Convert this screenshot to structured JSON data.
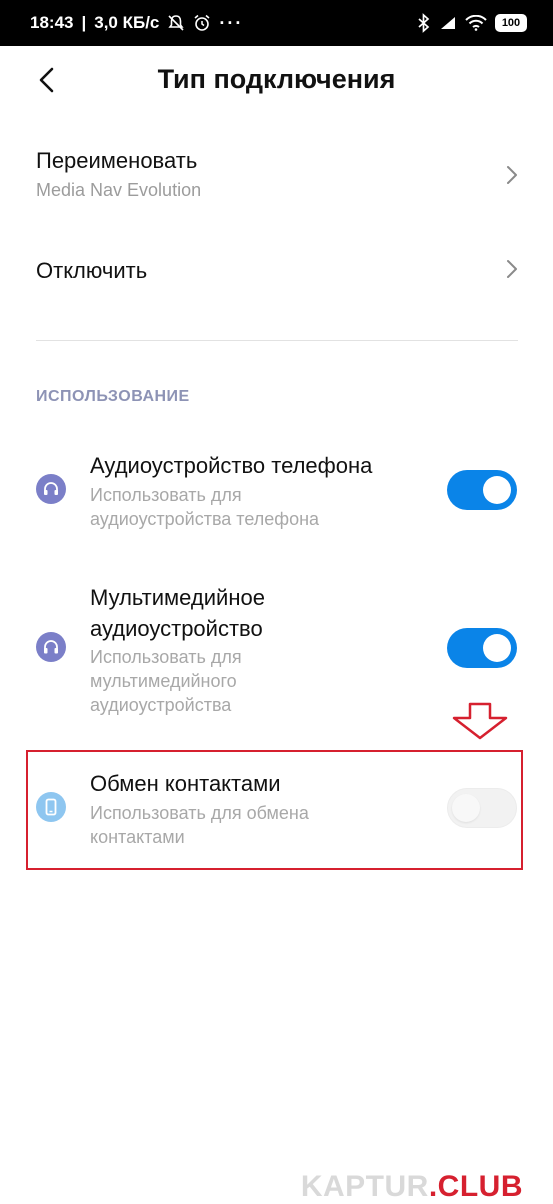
{
  "status_bar": {
    "time": "18:43",
    "speed": "3,0 КБ/с",
    "more": "···",
    "battery": "100"
  },
  "header": {
    "title": "Тип подключения"
  },
  "menu": {
    "rename": {
      "title": "Переименовать",
      "subtitle": "Media Nav Evolution"
    },
    "disconnect": {
      "title": "Отключить"
    }
  },
  "usage": {
    "section_title": "ИСПОЛЬЗОВАНИЕ",
    "items": [
      {
        "title_lines": [
          "Аудиоустройство телефона"
        ],
        "subtitle_lines": [
          "Использовать для",
          "аудиоустройства телефона"
        ],
        "icon": "headset-icon",
        "icon_color": "#7b7fc8",
        "enabled": true
      },
      {
        "title_lines": [
          "Мультимедийное",
          "аудиоустройство"
        ],
        "subtitle_lines": [
          "Использовать для",
          "мультимедийного",
          "аудиоустройства"
        ],
        "icon": "headphones-icon",
        "icon_color": "#7b7fc8",
        "enabled": true
      },
      {
        "title_lines": [
          "Обмен контактами"
        ],
        "subtitle_lines": [
          "Использовать для обмена",
          "контактами"
        ],
        "icon": "phone-icon",
        "icon_color": "#8ec6f0",
        "enabled": false
      }
    ]
  },
  "colors": {
    "accent": "#0a84e8",
    "highlight": "#d6202f",
    "section_header": "#8d93b5"
  },
  "watermark": {
    "part1": "KAPTUR",
    "part2": ".CLUB"
  }
}
